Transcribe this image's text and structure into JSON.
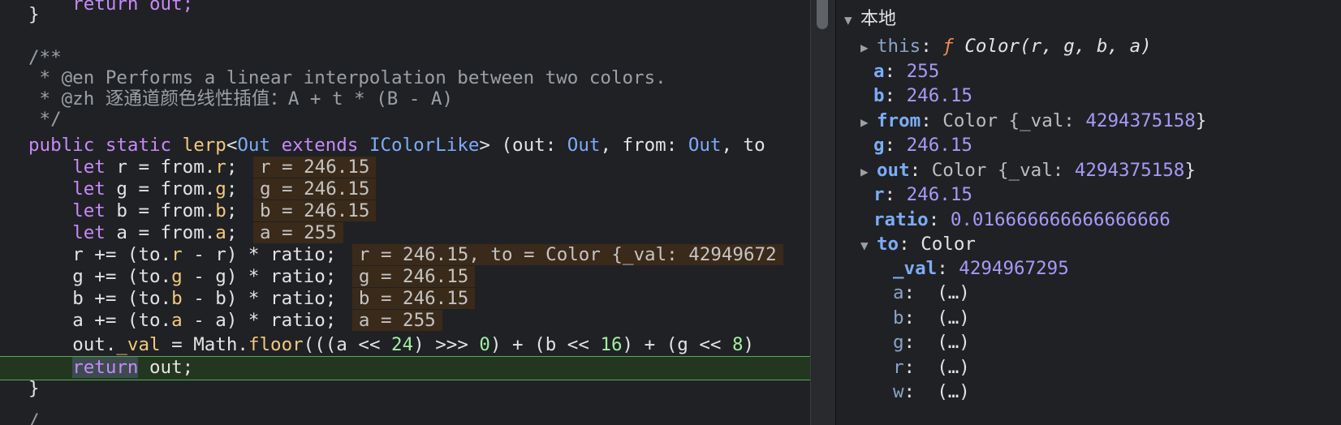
{
  "editor": {
    "lines": {
      "l0": "    return out;",
      "l1": "}",
      "l3": "/**",
      "l4": " * @en Performs a linear interpolation between two colors.",
      "l5": " * @zh 逐通道颜色线性插值：A + t * (B - A)",
      "l6": " */",
      "l7_public": "public",
      "l7_static": "static",
      "l7_lerp": "lerp",
      "l7_lt": "<",
      "l7_out": "Out",
      "l7_extends": "extends",
      "l7_icolor": "IColorLike",
      "l7_rest1": "> (out: ",
      "l7_out2": "Out",
      "l7_rest2": ", from: ",
      "l7_out3": "Out",
      "l7_rest3": ", to",
      "let": "let",
      "r_decl": " r = from.",
      "r_prop": "r",
      "g_decl": " g = from.",
      "g_prop": "g",
      "b_decl": " b = from.",
      "b_prop": "b",
      "a_decl": " a = from.",
      "a_prop": "a",
      "semi": ";",
      "r_inline": "r = 246.15",
      "g_inline": "g = 246.15",
      "b_inline": "b = 246.15",
      "a_inline": "a = 255",
      "r_acc_1": "r += (to.",
      "r_acc_p": "r",
      "r_acc_2": " - r) * ratio;",
      "r_acc_inline": "r = 246.15, to = Color {_val: 42949672",
      "g_acc_1": "g += (to.",
      "g_acc_p": "g",
      "g_acc_2": " - g) * ratio;",
      "g_acc_inline": "g = 246.15",
      "b_acc_1": "b += (to.",
      "b_acc_p": "b",
      "b_acc_2": " - b) * ratio;",
      "b_acc_inline": "b = 246.15",
      "a_acc_1": "a += (to.",
      "a_acc_p": "a",
      "a_acc_2": " - a) * ratio;",
      "a_acc_inline": "a = 255",
      "out_1": "out.",
      "out_val": "_val",
      "out_2": " = Math.",
      "out_floor": "floor",
      "out_3": "(((a << ",
      "n24": "24",
      "out_4": ") >>> ",
      "n0": "0",
      "out_5": ") + (b << ",
      "n16": "16",
      "out_6": ") + (g << ",
      "n8": "8",
      "out_7": ")",
      "ret_kw": "return",
      "ret_rest": " out;",
      "close": "}",
      "last": "/"
    }
  },
  "scope": {
    "title": "本地",
    "this_key": "this",
    "this_f": "ƒ",
    "this_val": "Color(r, g, b, a)",
    "a_key": "a",
    "a_val": "255",
    "b_key": "b",
    "b_val": "246.15",
    "from_key": "from",
    "from_type": "Color {_val: ",
    "from_val": "4294375158",
    "from_close": "}",
    "g_key": "g",
    "g_val": "246.15",
    "out_key": "out",
    "out_type": "Color {_val: ",
    "out_val": "4294375158",
    "out_close": "}",
    "r_key": "r",
    "r_val": "246.15",
    "ratio_key": "ratio",
    "ratio_val": "0.016666666666666666",
    "to_key": "to",
    "to_type": "Color",
    "val_key": "_val",
    "val_val": "4294967295",
    "getters": [
      {
        "key": "a",
        "val": "(…)"
      },
      {
        "key": "b",
        "val": "(…)"
      },
      {
        "key": "g",
        "val": "(…)"
      },
      {
        "key": "r",
        "val": "(…)"
      },
      {
        "key": "w",
        "val": "(…)"
      }
    ],
    "colon": ":"
  }
}
